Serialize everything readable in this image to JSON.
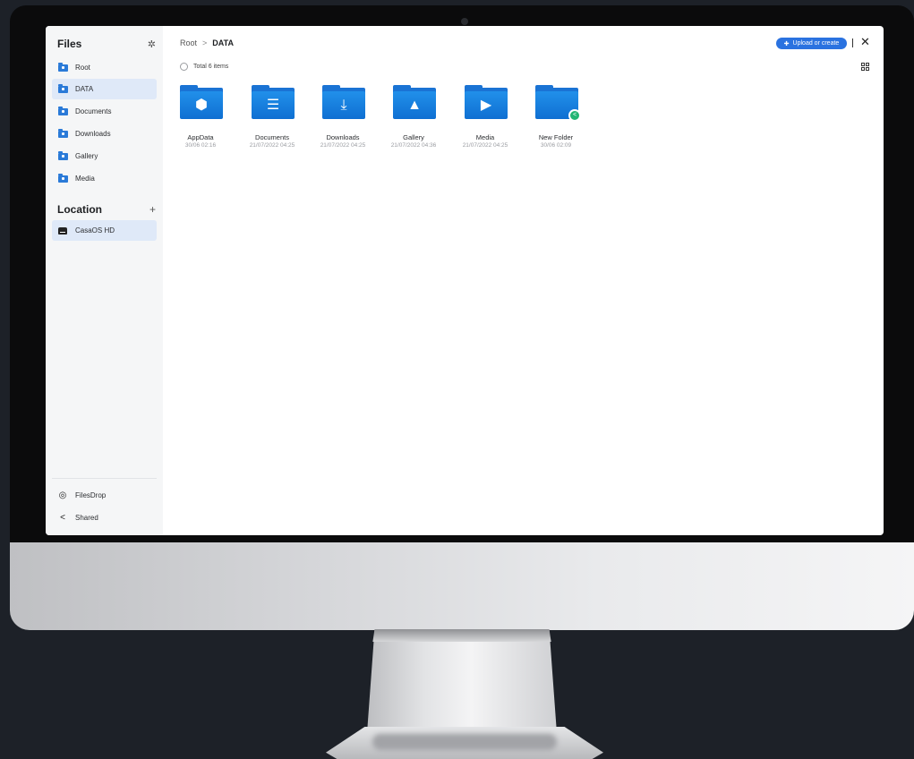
{
  "sidebar": {
    "title": "Files",
    "items": [
      {
        "label": "Root",
        "icon": "home-folder-icon"
      },
      {
        "label": "DATA",
        "icon": "data-folder-icon",
        "active": true
      },
      {
        "label": "Documents",
        "icon": "documents-folder-icon"
      },
      {
        "label": "Downloads",
        "icon": "downloads-folder-icon"
      },
      {
        "label": "Gallery",
        "icon": "gallery-folder-icon"
      },
      {
        "label": "Media",
        "icon": "media-folder-icon"
      }
    ],
    "location_title": "Location",
    "location_items": [
      {
        "label": "CasaOS HD",
        "icon": "hard-drive-icon"
      }
    ],
    "bottom_items": [
      {
        "label": "FilesDrop",
        "icon": "filesdrop-icon"
      },
      {
        "label": "Shared",
        "icon": "share-icon"
      }
    ]
  },
  "breadcrumb": {
    "root": "Root",
    "separator": ">",
    "current": "DATA"
  },
  "toolbar": {
    "total_label": "Total 6 items",
    "upload_label": "Upload or create",
    "close_glyph": "✕"
  },
  "files": [
    {
      "name": "AppData",
      "date": "30/06 02:16",
      "icon": "cube-icon"
    },
    {
      "name": "Documents",
      "date": "21/07/2022 04:25",
      "icon": "document-icon"
    },
    {
      "name": "Downloads",
      "date": "21/07/2022 04:25",
      "icon": "download-arrow-icon"
    },
    {
      "name": "Gallery",
      "date": "21/07/2022 04:36",
      "icon": "image-icon"
    },
    {
      "name": "Media",
      "date": "21/07/2022 04:25",
      "icon": "film-icon"
    },
    {
      "name": "New Folder",
      "date": "30/06 02:09",
      "icon": "shared-folder-icon"
    }
  ],
  "colors": {
    "accent": "#2a72e0",
    "folder": "#1a73d4",
    "active_bg": "#dfe9f8",
    "share_badge": "#22b573"
  }
}
